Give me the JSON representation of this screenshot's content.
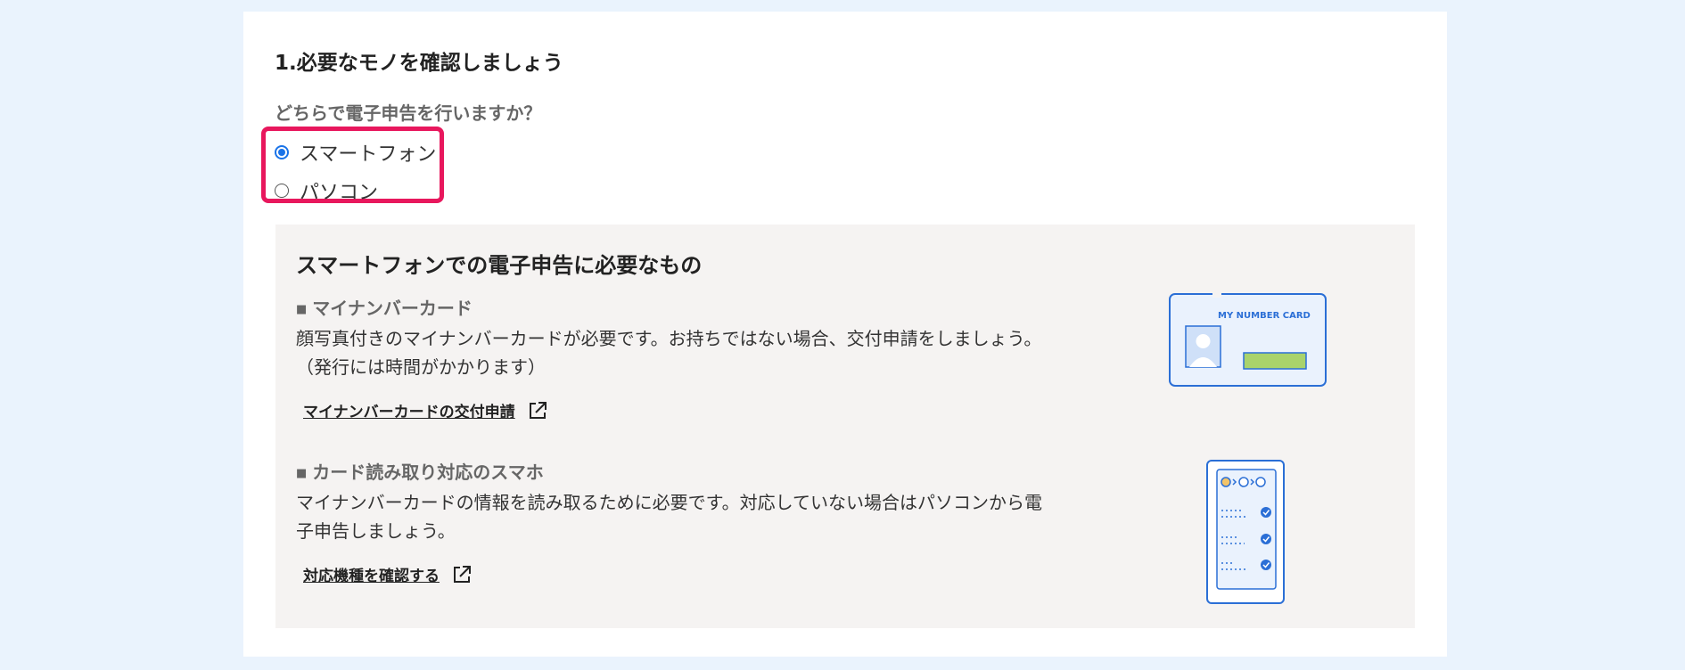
{
  "step": {
    "title": "1.必要なモノを確認しましょう"
  },
  "question": {
    "label": "どちらで電子申告を行いますか？"
  },
  "options": [
    {
      "label": "スマートフォン",
      "selected": true
    },
    {
      "label": "パソコン",
      "selected": false
    }
  ],
  "info": {
    "title": "スマートフォンでの電子申告に必要なもの",
    "items": [
      {
        "title": "マイナンバーカード",
        "desc_line1": "顔写真付きのマイナンバーカードが必要です。お持ちではない場合、交付申請をしましょう。",
        "desc_line2": "（発行には時間がかかります）",
        "link": "マイナンバーカードの交付申請",
        "illustration_text": "MY NUMBER CARD"
      },
      {
        "title": "カード読み取り対応のスマホ",
        "desc_line1": "マイナンバーカードの情報を読み取るために必要です。対応していない場合はパソコンから電",
        "desc_line2": "子申告しましょう。",
        "link": "対応機種を確認する"
      }
    ]
  },
  "colors": {
    "background": "#eaf3fd",
    "highlight_border": "#e8175d",
    "radio_selected": "#1a73e8",
    "info_panel": "#f5f3f2",
    "illustration_blue": "#2b6fd6",
    "card_field_green": "#a9d36b"
  },
  "icons": [
    "external-link-icon",
    "my-number-card-illustration",
    "smartphone-illustration",
    "check-icon"
  ]
}
